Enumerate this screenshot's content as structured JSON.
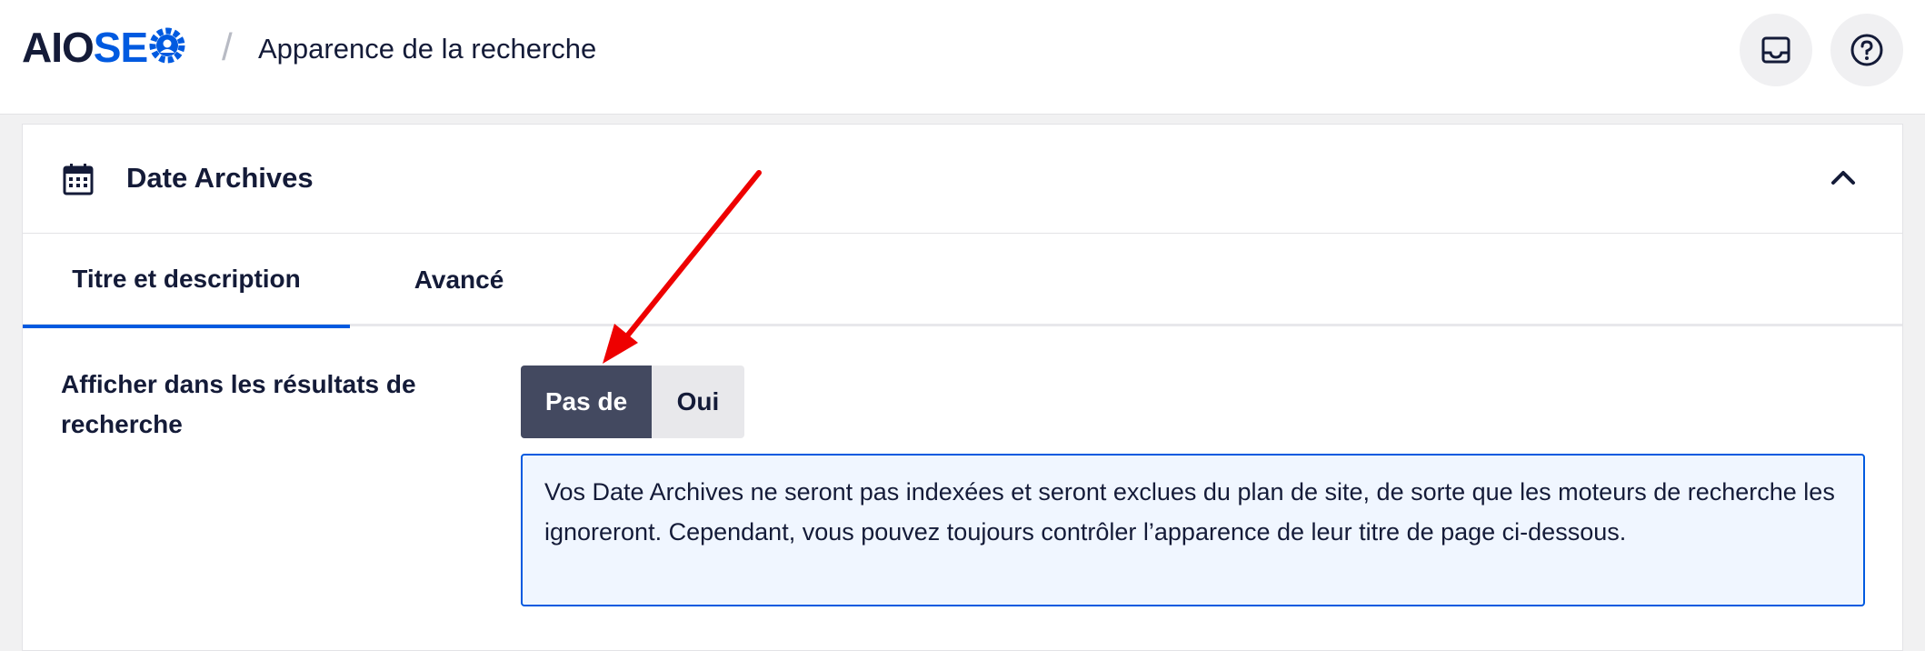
{
  "header": {
    "logo_left": "AIO",
    "logo_right": "SE",
    "breadcrumb_separator": "/",
    "title": "Apparence de la recherche",
    "icons": [
      "inbox-icon",
      "help-icon"
    ]
  },
  "card": {
    "title": "Date Archives",
    "icon": "calendar-icon",
    "collapse_icon": "chevron-up-icon"
  },
  "tabs": [
    {
      "label": "Titre et description",
      "active": true
    },
    {
      "label": "Avancé",
      "active": false
    }
  ],
  "setting": {
    "label": "Afficher dans les résultats de recherche",
    "options": [
      {
        "label": "Pas de",
        "selected": true
      },
      {
        "label": "Oui",
        "selected": false
      }
    ],
    "notice": "Vos Date Archives ne seront pas indexées et seront exclues du plan de site, de sorte que les moteurs de recherche les ignoreront. Cependant, vous pouvez toujours contrôler l’apparence de leur titre de page ci-dessous."
  },
  "colors": {
    "brand": "#005ae0",
    "dark": "#141b38",
    "toggle_active": "#434960",
    "annotation_arrow": "#ee0000"
  }
}
